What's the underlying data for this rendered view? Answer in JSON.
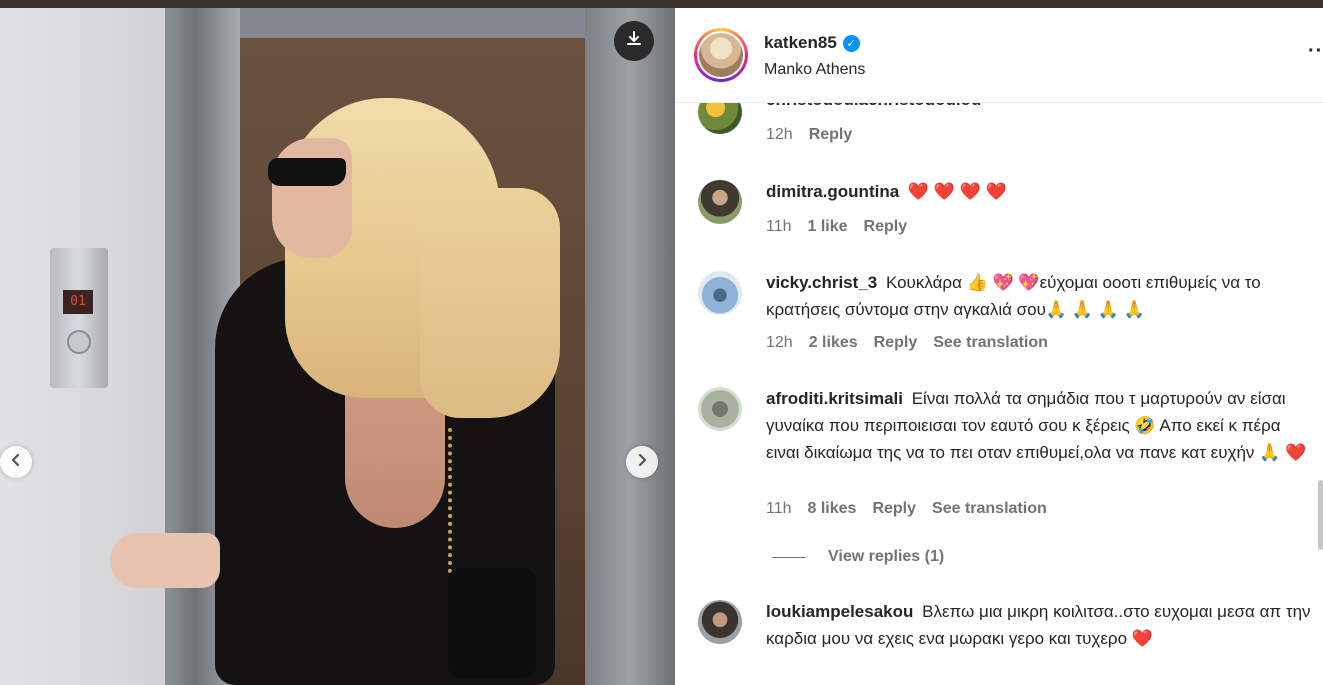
{
  "post": {
    "username": "katken85",
    "verified_icon": "verified-badge-icon",
    "location": "Manko Athens",
    "more_label": "…"
  },
  "photo": {
    "elevator_display": "01",
    "download_icon": "download-icon",
    "prev_icon": "chevron-left-icon",
    "next_icon": "chevron-right-icon"
  },
  "comments": [
    {
      "username": "christodoulachristodoulou",
      "text": "",
      "time": "12h",
      "likes": "",
      "reply": "Reply",
      "translation": ""
    },
    {
      "username": "dimitra.gountina",
      "text": "❤️ ❤️ ❤️ ❤️",
      "time": "11h",
      "likes": "1 like",
      "reply": "Reply",
      "translation": ""
    },
    {
      "username": "vicky.christ_3",
      "text": "Κουκλάρα 👍 💖 💖εύχομαι οοοτι επιθυμείς να το κρατήσεις σύντομα στην αγκαλιά σου🙏 🙏 🙏 🙏",
      "time": "12h",
      "likes": "2 likes",
      "reply": "Reply",
      "translation": "See translation"
    },
    {
      "username": "afroditi.kritsimali",
      "text": "Είναι πολλά τα σημάδια που τ μαρτυρούν αν είσαι γυναίκα που περιποιεισαι τον εαυτό σου κ ξέρεις 🤣 Απο εκεί κ πέρα ειναι δικαίωμα της να το πει οταν επιθυμεί,ολα να πανε κατ ευχήν 🙏 ❤️",
      "time": "11h",
      "likes": "8 likes",
      "reply": "Reply",
      "translation": "See translation"
    },
    {
      "username": "loukiampelesakou",
      "text": "Βλεπω μια μικρη κοιλιτσα..στο ευχομαι μεσα απ την καρδια μου να εχεις ενα μωρακι γερο και τυχερο ❤️",
      "time": "",
      "likes": "",
      "reply": "",
      "translation": ""
    }
  ],
  "view_replies": "View replies (1)",
  "colors": {
    "accent": "#0095f6",
    "heart": "#ed1f4f",
    "meta": "#737373",
    "text": "#262626"
  }
}
